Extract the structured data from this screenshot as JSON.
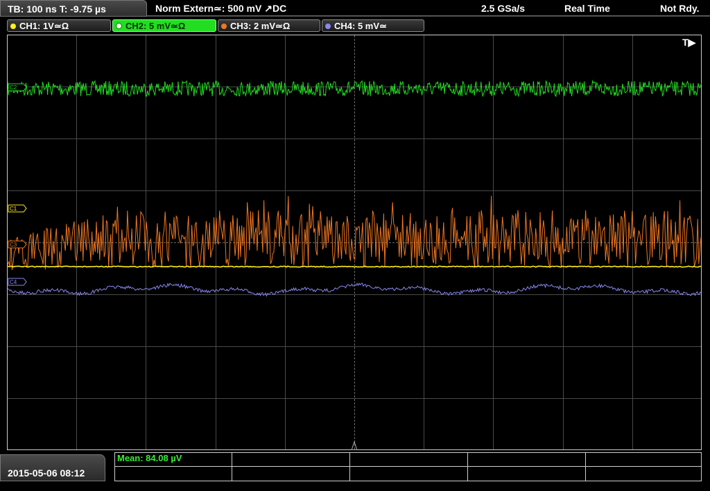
{
  "header": {
    "timebase": "TB: 100 ns   T: -9.75 µs",
    "trigger": "Norm    Extern≃: 500 mV ↗DC",
    "sample_rate": "2.5 GSa/s",
    "acq_mode": "Real Time",
    "status": "Not Rdy."
  },
  "channels": [
    {
      "id": "ch1",
      "label": "CH1: 1V≃Ω",
      "color": "#ffee22",
      "marker": "C1"
    },
    {
      "id": "ch2",
      "label": "CH2: 5 mV≃Ω",
      "color": "#22dd22",
      "marker": "C2"
    },
    {
      "id": "ch3",
      "label": "CH3: 2 mV≃Ω",
      "color": "#ee7722",
      "marker": "C3"
    },
    {
      "id": "ch4",
      "label": "CH4: 5 mV≃",
      "color": "#8888ee",
      "marker": "C4"
    }
  ],
  "trigger_marker": "T▶",
  "footer": {
    "datetime": "2015-05-06 08:12",
    "measurement": "Mean: 84.08 µV"
  },
  "colors": {
    "grid": "#4a4a4a",
    "grid_center": "#6a6a6a",
    "frame": "#cfcfcf"
  }
}
